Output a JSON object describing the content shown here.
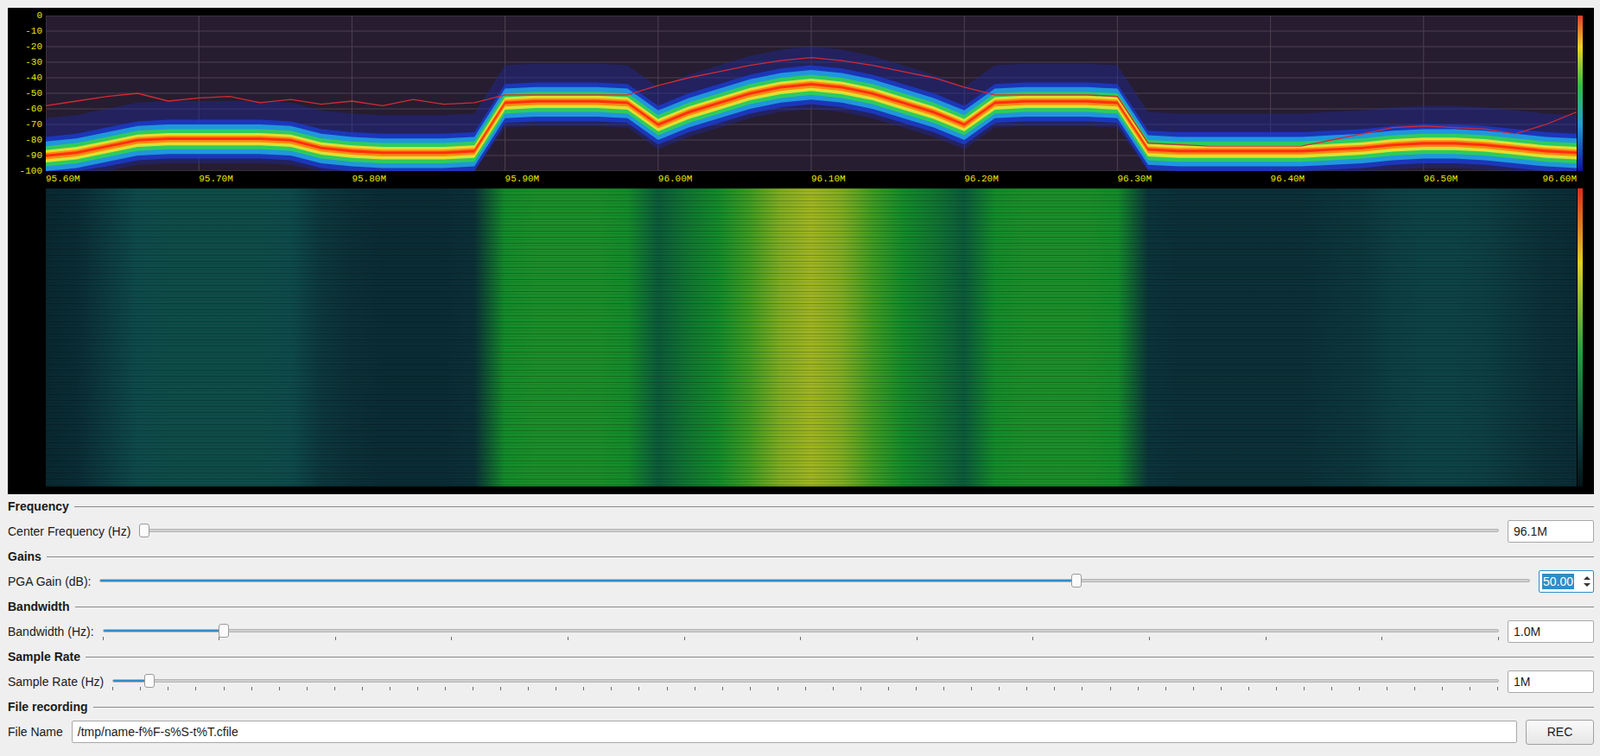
{
  "spectrum": {
    "y_ticks": [
      "0",
      "-10",
      "-20",
      "-30",
      "-40",
      "-50",
      "-60",
      "-70",
      "-80",
      "-90",
      "-100"
    ],
    "x_ticks": [
      "95.60M",
      "95.70M",
      "95.80M",
      "95.90M",
      "96.00M",
      "96.10M",
      "96.20M",
      "96.30M",
      "96.40M",
      "96.50M",
      "96.60M"
    ],
    "freq_mhz": [
      95.6,
      95.62,
      95.64,
      95.66,
      95.68,
      95.7,
      95.72,
      95.74,
      95.76,
      95.78,
      95.8,
      95.82,
      95.84,
      95.86,
      95.88,
      95.9,
      95.92,
      95.94,
      95.96,
      95.98,
      96.0,
      96.02,
      96.04,
      96.06,
      96.08,
      96.1,
      96.12,
      96.14,
      96.16,
      96.18,
      96.2,
      96.22,
      96.24,
      96.26,
      96.28,
      96.3,
      96.32,
      96.34,
      96.36,
      96.38,
      96.4,
      96.42,
      96.44,
      96.46,
      96.48,
      96.5,
      96.52,
      96.54,
      96.56,
      96.58,
      96.6
    ],
    "series": [
      {
        "name": "average",
        "values": [
          -90,
          -88,
          -84,
          -80,
          -79,
          -79,
          -79,
          -79,
          -80,
          -85,
          -87,
          -88,
          -88,
          -88,
          -87,
          -56,
          -55,
          -55,
          -55,
          -56,
          -70,
          -62,
          -56,
          -50,
          -46,
          -44,
          -46,
          -50,
          -56,
          -62,
          -70,
          -56,
          -55,
          -55,
          -55,
          -56,
          -86,
          -87,
          -87,
          -87,
          -87,
          -87,
          -86,
          -85,
          -83,
          -82,
          -82,
          -83,
          -85,
          -87,
          -88
        ]
      },
      {
        "name": "max hold",
        "color": "#d42a33",
        "values": [
          -58,
          -55,
          -52,
          -50,
          -55,
          -53,
          -52,
          -56,
          -54,
          -57,
          -55,
          -58,
          -54,
          -57,
          -56,
          -51,
          -51,
          -51,
          -51,
          -51,
          -45,
          -40,
          -36,
          -32,
          -29,
          -27,
          -29,
          -32,
          -36,
          -40,
          -46,
          -51,
          -51,
          -51,
          -51,
          -52,
          -82,
          -83,
          -84,
          -84,
          -84,
          -84,
          -80,
          -76,
          -72,
          -71,
          -72,
          -73,
          -76,
          -70,
          -62
        ]
      }
    ]
  },
  "sections": [
    {
      "title": "Frequency",
      "control": {
        "kind": "slider",
        "label": "Center Frequency (Hz)",
        "level": 0,
        "value": "96.1M",
        "ticks": 0
      }
    },
    {
      "title": "Gains",
      "control": {
        "kind": "spin",
        "label": "PGA Gain (dB):",
        "level": 0.684,
        "value": "50.00",
        "value_selected": true,
        "ticks": 0
      }
    },
    {
      "title": "Bandwidth",
      "control": {
        "kind": "slider",
        "label": "Bandwidth (Hz):",
        "level": 0.084,
        "value": "1.0M",
        "ticks": 13
      }
    },
    {
      "title": "Sample Rate",
      "control": {
        "kind": "slider",
        "label": "Sample Rate (Hz)",
        "level": 0.023,
        "value": "1M",
        "ticks": 51
      }
    },
    {
      "title": "File recording",
      "control": {
        "kind": "file",
        "label": "File Name",
        "value": "/tmp/name-f%F-s%S-t%T.cfile",
        "button": "REC"
      }
    }
  ]
}
